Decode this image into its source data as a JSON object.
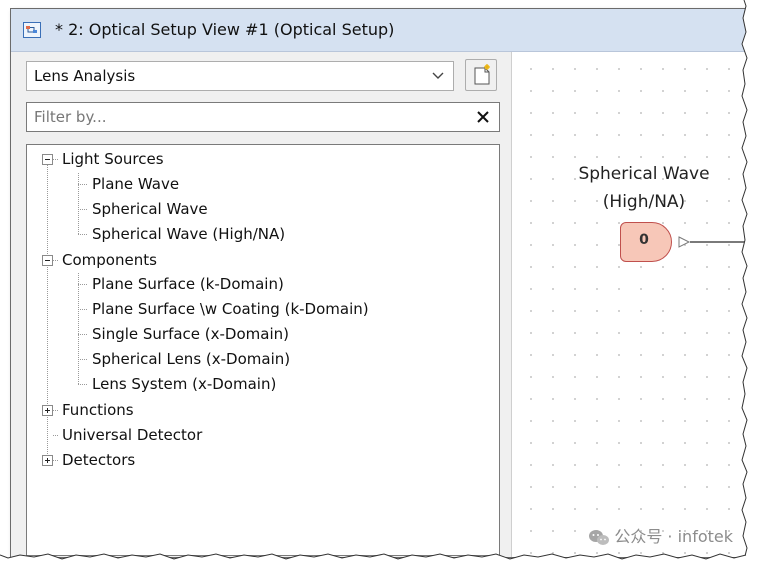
{
  "window": {
    "title": "* 2: Optical Setup View #1 (Optical Setup)",
    "title_icon": "optical-setup-view-icon"
  },
  "panel": {
    "dropdown": {
      "selected": "Lens Analysis",
      "icon": "chevron-down-icon"
    },
    "new_button_icon": "new-document-icon",
    "filter": {
      "placeholder": "Filter by...",
      "value": "",
      "clear_icon": "close-icon"
    },
    "tree": {
      "light_sources": {
        "label": "Light Sources",
        "expanded": true,
        "children": [
          "Plane Wave",
          "Spherical Wave",
          "Spherical Wave (High/NA)"
        ]
      },
      "components": {
        "label": "Components",
        "expanded": true,
        "children": [
          "Plane Surface (k-Domain)",
          "Plane Surface \\w Coating (k-Domain)",
          "Single Surface (x-Domain)",
          "Spherical Lens (x-Domain)",
          "Lens System (x-Domain)"
        ]
      },
      "functions": {
        "label": "Functions",
        "expanded": false
      },
      "universal_detector": {
        "label": "Universal Detector"
      },
      "detectors": {
        "label": "Detectors",
        "expanded": false
      }
    }
  },
  "canvas": {
    "node": {
      "label_line1": "Spherical Wave",
      "label_line2": "(High/NA)",
      "count": "0",
      "fill": "#f7c7b8",
      "border": "#c0504d"
    },
    "watermark": "公众号 · infotek"
  }
}
